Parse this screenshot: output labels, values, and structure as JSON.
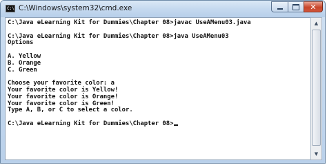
{
  "window": {
    "title": "C:\\Windows\\system32\\cmd.exe",
    "icon": "cmd-icon",
    "icon_text": "C:\\",
    "controls": {
      "minimize_icon": "minimize-icon",
      "maximize_icon": "maximize-icon",
      "close_icon": "close-icon",
      "close_glyph": "✕"
    }
  },
  "console": {
    "lines": [
      "C:\\Java eLearning Kit for Dummies\\Chapter 08>javac UseAMenu03.java",
      "",
      "C:\\Java eLearning Kit for Dummies\\Chapter 08>java UseAMenu03",
      "Options",
      "",
      "A. Yellow",
      "B. Orange",
      "C. Green",
      "",
      "Choose your favorite color: a",
      "Your favorite color is Yellow!",
      "Your favorite color is Orange!",
      "Your favorite color is Green!",
      "Type A, B, or C to select a color.",
      "",
      "C:\\Java eLearning Kit for Dummies\\Chapter 08>"
    ]
  },
  "scrollbar": {
    "up_glyph": "▲",
    "down_glyph": "▼",
    "colors": {
      "track": "#eceef1",
      "thumb": "#dde2e9"
    }
  },
  "colors": {
    "titlebar": "#c5d9ef",
    "console_background": "#ffffff",
    "console_text": "#111111",
    "close_button": "#c8452a"
  }
}
